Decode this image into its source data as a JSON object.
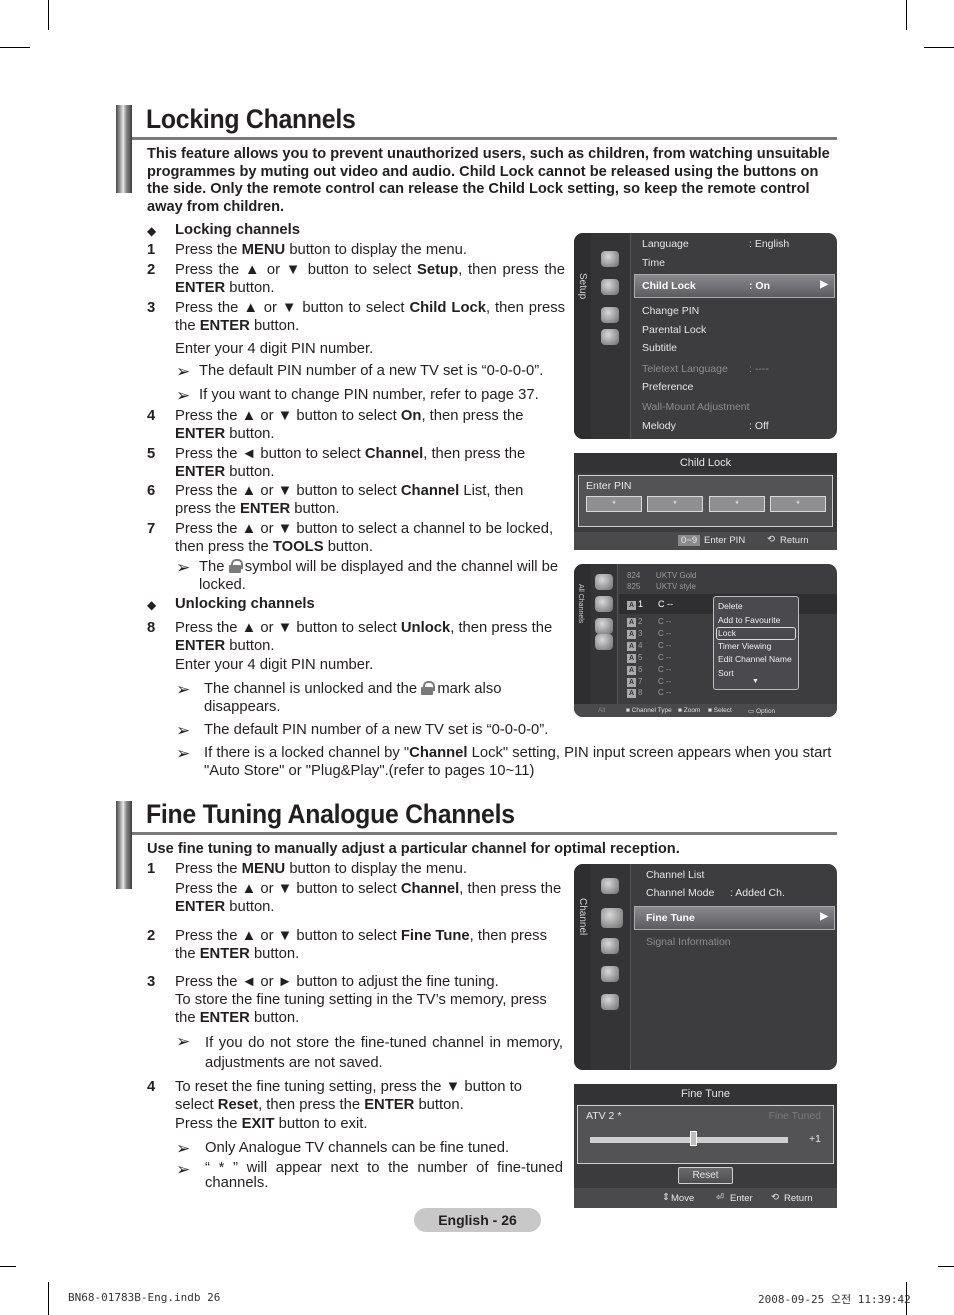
{
  "section1": {
    "title": "Locking Channels",
    "intro": "This feature allows you to prevent unauthorized users, such as children, from watching unsuitable programmes by muting out video and audio. Child Lock cannot be released using the buttons on the side. Only the remote control can release the Child Lock setting, so keep the remote control away from children.",
    "subhead_lock": "Locking channels",
    "steps": [
      {
        "num": "1",
        "pre": "Press the ",
        "bold": "MENU",
        "post": " button to display the menu."
      },
      {
        "num": "2",
        "text": "Press the ▲ or ▼ button to select Setup, then press the ENTER button."
      },
      {
        "num": "3",
        "text": "Press the ▲ or ▼ button to select Child Lock, then press the ENTER button."
      },
      {
        "num": "4",
        "text": "Press the ▲ or ▼ button to select On, then press the ENTER button."
      },
      {
        "num": "5",
        "text": "Press the ◄ button to select Channel, then press the ENTER button."
      },
      {
        "num": "6",
        "text": "Press the ▲ or ▼ button to select Channel List, then press the ENTER button."
      },
      {
        "num": "7",
        "text": "Press the ▲ or ▼ button to select a channel to be locked, then press the TOOLS button."
      }
    ],
    "enter_pin": "Enter your 4 digit PIN number.",
    "note_default_pin": "The default PIN number of a new TV set is “0-0-0-0”.",
    "note_change_pin": "If you want to change PIN number, refer to page 37.",
    "note_lock_symbol_a": "The",
    "note_lock_symbol_b": "symbol will be displayed and the channel will be locked.",
    "subhead_unlock": "Unlocking channels",
    "step8": {
      "num": "8",
      "text": "Press the ▲ or ▼ button to select Unlock, then press the ENTER button."
    },
    "enter_pin2": "Enter your 4 digit PIN number.",
    "note_unlocked_a": "The channel is unlocked and the",
    "note_unlocked_b": "mark also disappears.",
    "note_default_pin2": "The default PIN number of a new TV set is “0-0-0-0”.",
    "note_locked_channel": "If there is a locked channel by \"Channel Lock\" setting, PIN input screen appears when you start \"Auto Store\" or \"Plug&Play\".(refer to pages 10~11)"
  },
  "setup_menu": {
    "side_label": "Setup",
    "items": [
      {
        "label": "Language",
        "value": ": English",
        "dim": false
      },
      {
        "label": "Time",
        "value": "",
        "dim": false
      },
      {
        "label": "Child Lock",
        "value": ": On",
        "selected": true
      },
      {
        "label": "Change PIN",
        "value": "",
        "dim": false
      },
      {
        "label": "Parental Lock",
        "value": "",
        "dim": false
      },
      {
        "label": "Subtitle",
        "value": "",
        "dim": false
      },
      {
        "label": "Teletext Language",
        "value": ": ----",
        "dim": true
      },
      {
        "label": "Preference",
        "value": "",
        "dim": false
      },
      {
        "label": "Wall-Mount Adjustment",
        "value": "",
        "dim": true
      },
      {
        "label": "Melody",
        "value": ": Off",
        "dim": false
      }
    ]
  },
  "child_lock_dialog": {
    "title": "Child Lock",
    "enter_pin_label": "Enter PIN",
    "pin_digits": [
      "*",
      "*",
      "*",
      "*"
    ],
    "hint_key": "0~9",
    "hint_label": "Enter PIN",
    "return_label": "Return"
  },
  "channel_list": {
    "side_label": "All Channels",
    "top_rows": [
      {
        "num": "824",
        "name": "UKTV Gold"
      },
      {
        "num": "825",
        "name": "UKTV style"
      }
    ],
    "rows": [
      {
        "num": "1",
        "name": "C --"
      },
      {
        "num": "2",
        "name": "C --"
      },
      {
        "num": "3",
        "name": "C --"
      },
      {
        "num": "4",
        "name": "C --"
      },
      {
        "num": "5",
        "name": "C --"
      },
      {
        "num": "6",
        "name": "C --"
      },
      {
        "num": "7",
        "name": "C --"
      },
      {
        "num": "8",
        "name": "C --"
      }
    ],
    "badge": "A",
    "popup": [
      "Delete",
      "Add to Favourite",
      "Lock",
      "Timer Viewing",
      "Edit Channel Name",
      "Sort"
    ],
    "popup_selected": "Lock",
    "footer": {
      "all": "All",
      "channel_type": "Channel Type",
      "zoom": "Zoom",
      "select": "Select",
      "option": "Option"
    }
  },
  "section2": {
    "title": "Fine Tuning Analogue Channels",
    "intro": "Use fine tuning to manually adjust a particular channel for optimal reception.",
    "step1a": "Press the MENU button to display the menu.",
    "step1b": "Press the ▲ or ▼ button to select Channel, then press the ENTER button.",
    "step2": "Press the ▲ or ▼ button to select Fine Tune, then press the ENTER button.",
    "step3a": "Press the ◄ or ► button to adjust the fine tuning.",
    "step3b": "To store the fine tuning setting in the TV’s memory, press the ENTER button.",
    "note_not_saved": "If you do not store the fine-tuned channel in memory, adjustments are not saved.",
    "step4a": "To reset the fine tuning setting, press the ▼ button to select Reset, then press the ENTER button.",
    "step4b": "Press the EXIT button to exit.",
    "note_analogue_only": "Only Analogue TV channels can be fine tuned.",
    "note_asterisk": "“ * ” will appear next to the number of fine-tuned channels."
  },
  "channel_menu": {
    "side_label": "Channel",
    "items": [
      {
        "label": "Channel List",
        "value": ""
      },
      {
        "label": "Channel Mode",
        "value": ": Added Ch."
      },
      {
        "label": "Fine Tune",
        "value": "",
        "selected": true
      },
      {
        "label": "Signal Information",
        "value": "",
        "dim": true
      }
    ]
  },
  "fine_tune_dialog": {
    "title": "Fine Tune",
    "channel": "ATV 2 *",
    "status": "Fine Tuned",
    "value": "+1",
    "slider_fraction": 0.52,
    "reset_label": "Reset",
    "footer": {
      "move": "Move",
      "enter": "Enter",
      "return": "Return"
    }
  },
  "page": {
    "badge": "English - 26",
    "footer_left": "BN68-01783B-Eng.indb   26",
    "footer_right": "2008-09-25   오전 11:39:42"
  }
}
